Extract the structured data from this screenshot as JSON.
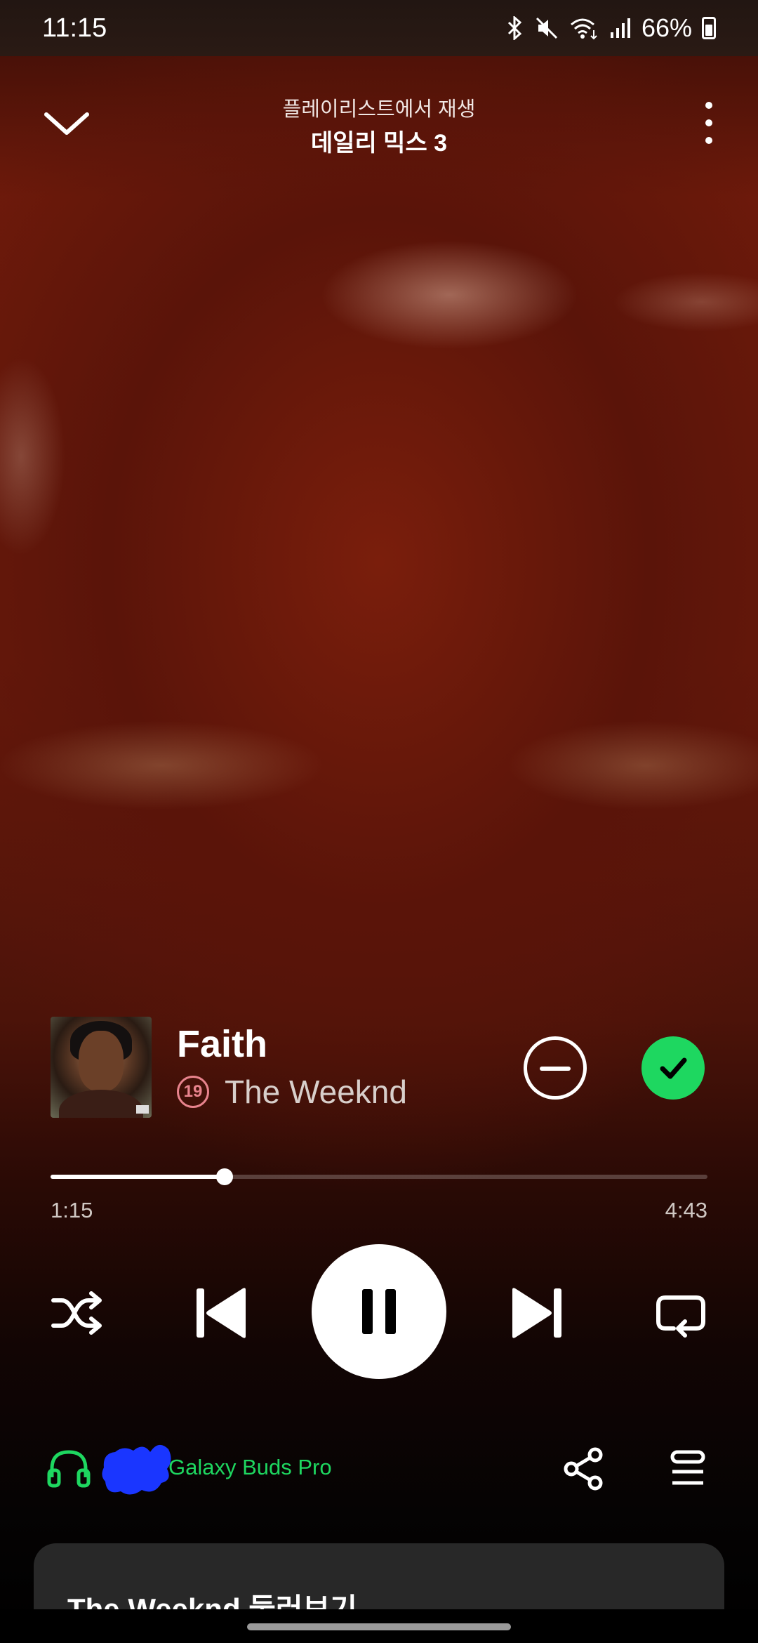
{
  "status_bar": {
    "time": "11:15",
    "battery_percent": "66%",
    "icons": [
      "bluetooth-icon",
      "mute-icon",
      "wifi-icon",
      "signal-icon",
      "battery-icon"
    ]
  },
  "header": {
    "context_label": "플레이리스트에서 재생",
    "playlist_name": "데일리 믹스 3",
    "icons": [
      "chevron-down-icon",
      "more-vert-icon"
    ]
  },
  "track": {
    "title": "Faith",
    "age_rating": "19",
    "artist": "The Weeknd",
    "liked": true
  },
  "progress": {
    "elapsed": "1:15",
    "duration": "4:43",
    "fraction": 0.265
  },
  "controls": {
    "icons": [
      "shuffle-icon",
      "previous-icon",
      "pause-icon",
      "next-icon",
      "repeat-icon"
    ],
    "state": "playing"
  },
  "output": {
    "device": "Galaxy Buds Pro",
    "icons": [
      "headphones-icon",
      "share-icon",
      "queue-icon"
    ]
  },
  "card": {
    "title": "The Weeknd 둘러보기"
  },
  "colors": {
    "accent": "#1ed760",
    "rating": "#e8838d"
  }
}
